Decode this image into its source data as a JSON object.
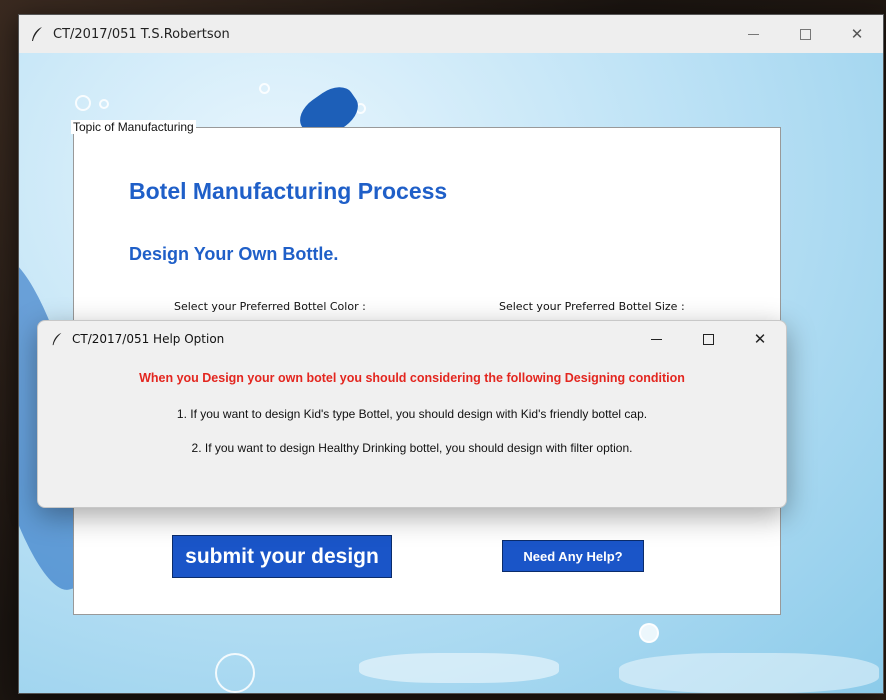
{
  "main_window": {
    "title": "CT/2017/051 T.S.Robertson",
    "frame_label": "Topic of Manufacturing",
    "heading": "Botel Manufacturing Process",
    "subheading": "Design Your Own Bottle.",
    "color_label": "Select your Preferred Bottel Color :",
    "size_label": "Select your Preferred Bottel Size :",
    "submit_label": "submit your design",
    "help_label": "Need Any Help?"
  },
  "help_dialog": {
    "title": "CT/2017/051 Help Option",
    "heading": "When you Design your own botel you should considering the following Designing condition",
    "line1": "1. If you want to design Kid's type Bottel, you should design with Kid's friendly bottel cap.",
    "line2": "2. If you want to design Healthy Drinking bottel, you should design with filter option."
  },
  "window_controls": {
    "minimize": "—",
    "close": "✕"
  },
  "colors": {
    "accent_blue": "#1f5fc8",
    "button_blue": "#1a55c8",
    "warning_red": "#e3261f"
  }
}
